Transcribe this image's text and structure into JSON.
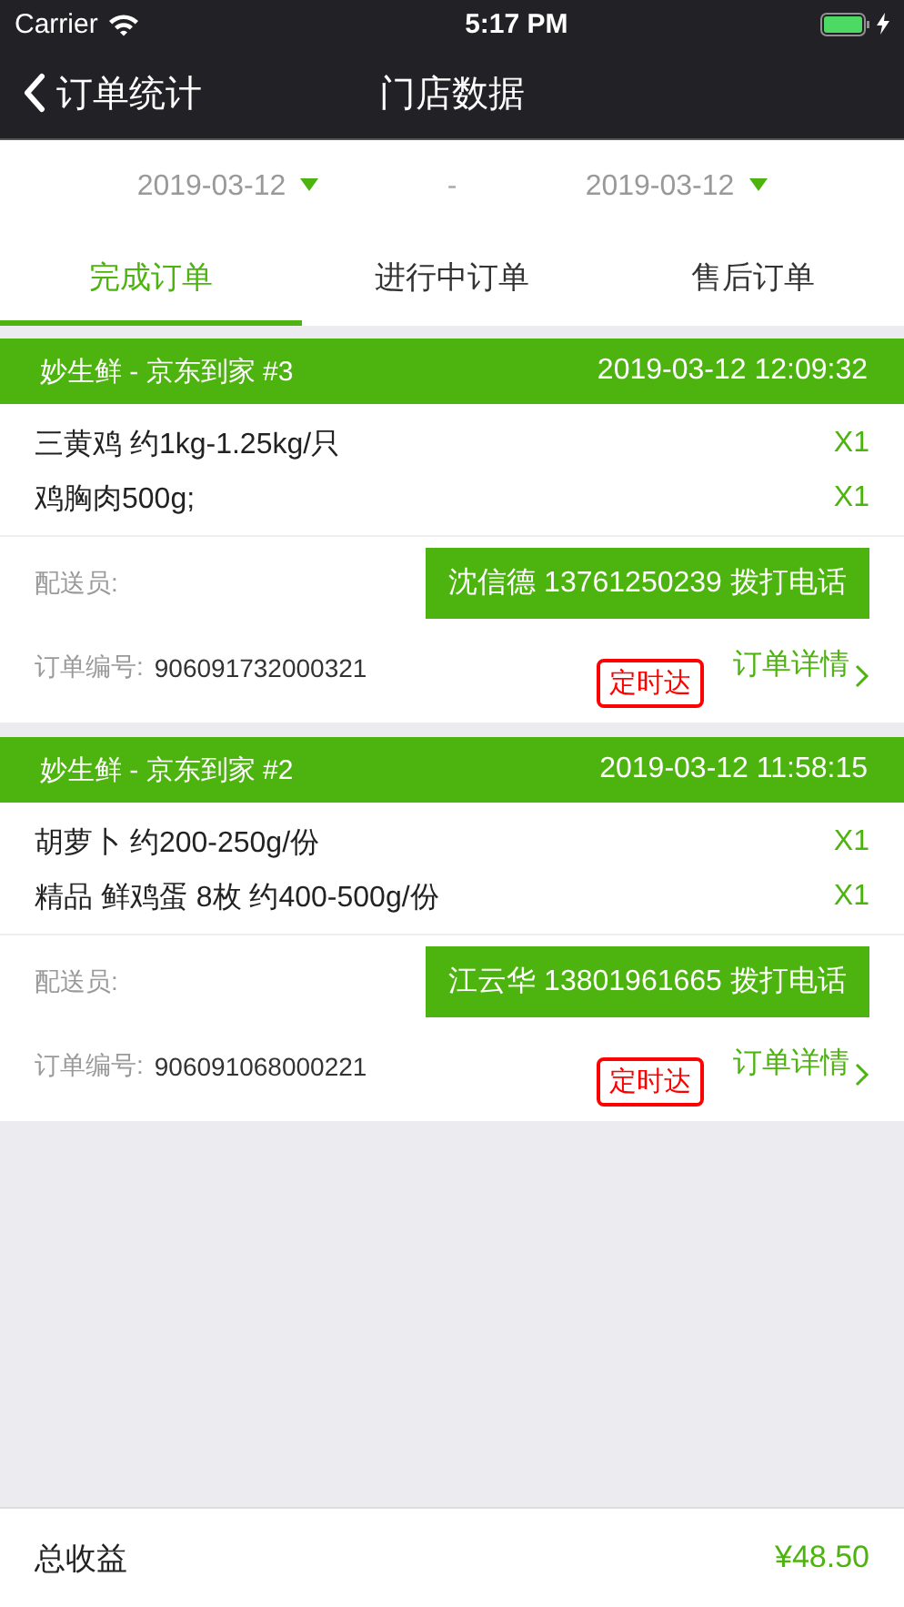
{
  "status_bar": {
    "carrier": "Carrier",
    "time": "5:17 PM"
  },
  "nav": {
    "back_label": "订单统计",
    "title": "门店数据"
  },
  "date_range": {
    "start": "2019-03-12",
    "separator": "-",
    "end": "2019-03-12"
  },
  "tabs": [
    {
      "label": "完成订单",
      "selected": true
    },
    {
      "label": "进行中订单",
      "selected": false
    },
    {
      "label": "售后订单",
      "selected": false
    }
  ],
  "orders": [
    {
      "source": "妙生鲜 - 京东到家 #3",
      "time": "2019-03-12 12:09:32",
      "items": [
        {
          "name": "三黄鸡 约1kg-1.25kg/只",
          "qty": "X1"
        },
        {
          "name": "鸡胸肉500g;",
          "qty": "X1"
        }
      ],
      "courier_label": "配送员:",
      "call_button": "沈信德 13761250239 拨打电话",
      "number_label": "订单编号:",
      "number": "906091732000321",
      "tag": "定时达",
      "details_link": "订单详情"
    },
    {
      "source": "妙生鲜 - 京东到家 #2",
      "time": "2019-03-12 11:58:15",
      "items": [
        {
          "name": "胡萝卜 约200-250g/份",
          "qty": "X1"
        },
        {
          "name": "精品 鲜鸡蛋 8枚 约400-500g/份",
          "qty": "X1"
        }
      ],
      "courier_label": "配送员:",
      "call_button": "江云华 13801961665 拨打电话",
      "number_label": "订单编号:",
      "number": "906091068000221",
      "tag": "定时达",
      "details_link": "订单详情"
    }
  ],
  "footer": {
    "label": "总收益",
    "amount": "¥48.50"
  }
}
